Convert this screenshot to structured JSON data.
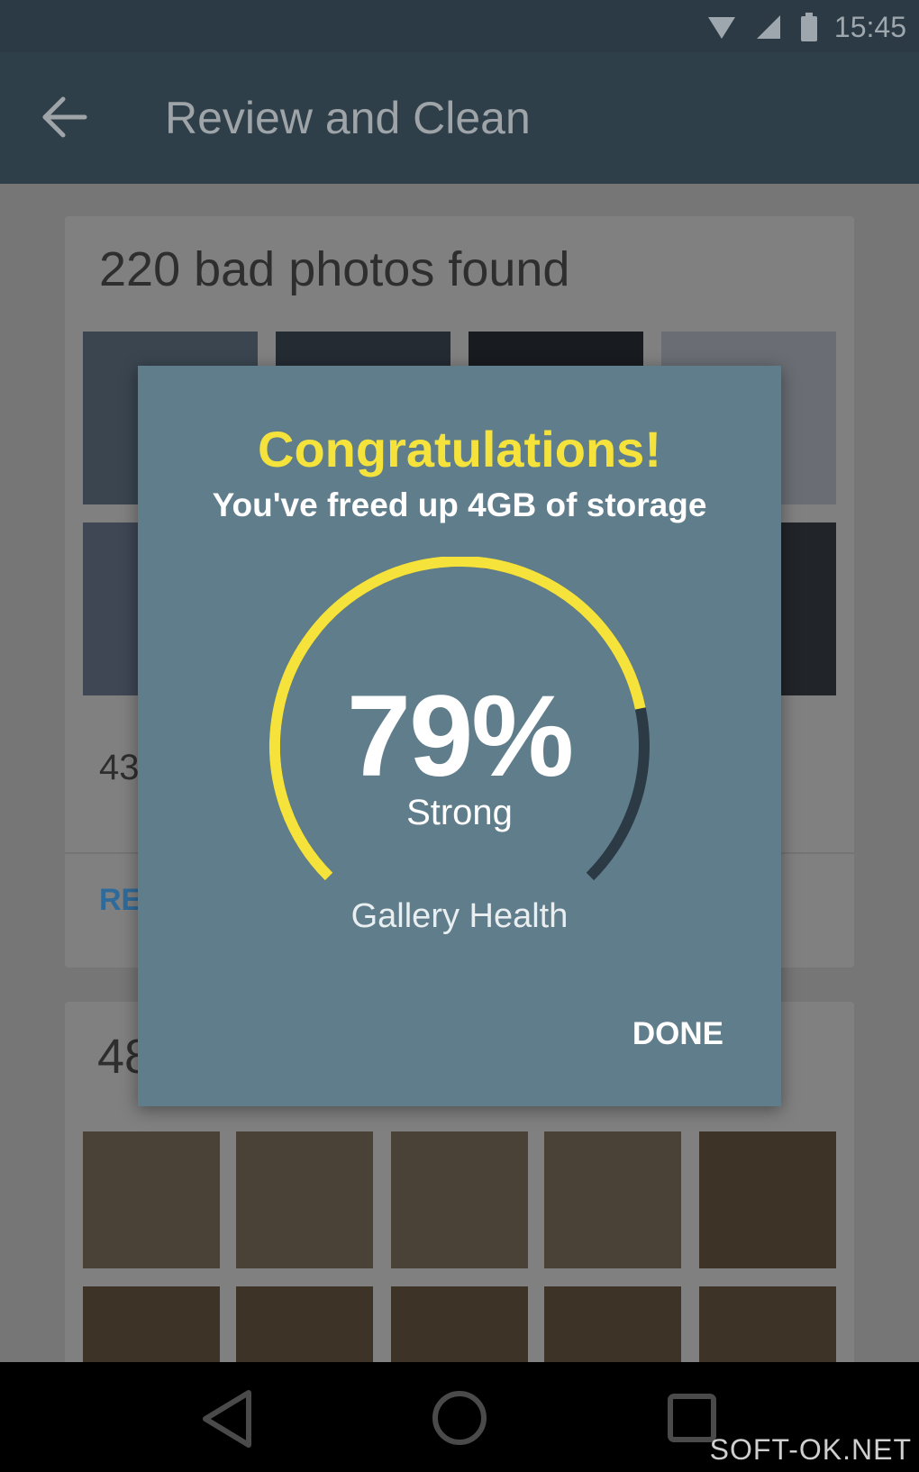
{
  "status_bar": {
    "time": "15:45"
  },
  "app_bar": {
    "title": "Review and Clean"
  },
  "cards": {
    "card1_title": "220 bad photos found",
    "card1_count_fragment": "43",
    "card1_action_fragment": "RE",
    "card2_title_fragment": "48"
  },
  "dialog": {
    "title": "Congratulations!",
    "subtitle": "You've freed up 4GB of storage",
    "percent_text": "79%",
    "percent_value": 79,
    "strength": "Strong",
    "gauge_label": "Gallery Health",
    "done_label": "DONE"
  },
  "watermark": "SOFT-OK.NET",
  "colors": {
    "dialog_bg": "#607d8b",
    "gauge_fill": "#f5e33b",
    "gauge_track": "#2b3a44",
    "title": "#f5e33b"
  },
  "icons": {
    "back": "back-arrow-icon",
    "wifi": "wifi-icon",
    "signal": "signal-icon",
    "battery": "battery-icon",
    "nav_back": "nav-back-icon",
    "nav_home": "nav-home-icon",
    "nav_recents": "nav-recents-icon"
  }
}
